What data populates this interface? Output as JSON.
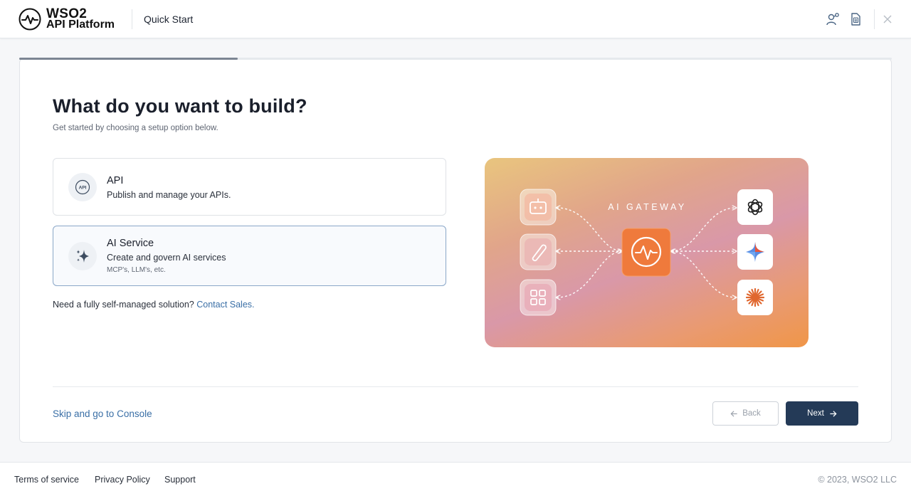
{
  "brand": {
    "line1": "WSO2",
    "line2": "API Platform"
  },
  "header": {
    "title": "Quick Start"
  },
  "progress": {
    "fraction": 0.25
  },
  "main": {
    "title": "What do you want to build?",
    "subtitle": "Get started by choosing a setup option below.",
    "options": [
      {
        "title": "API",
        "description": "Publish and manage your APIs.",
        "icon": "api-icon",
        "selected": false
      },
      {
        "title": "AI Service",
        "description": "Create and govern AI services",
        "note": "MCP's, LLM's, etc.",
        "icon": "sparkle-icon",
        "selected": true
      }
    ],
    "contact_prefix": "Need a fully self-managed solution? ",
    "contact_link": "Contact Sales."
  },
  "illustration": {
    "label": "AI GATEWAY",
    "left_icons": [
      "robot-icon",
      "paperclip-icon",
      "grid-icon"
    ],
    "center_icon": "pulse-icon",
    "right_icons": [
      "openai-icon",
      "gemini-icon",
      "claude-icon"
    ],
    "colors": {
      "gradient_start": "#e9c57e",
      "gradient_mid": "#d998a8",
      "gradient_end": "#f09648",
      "hub": "#ef7a3c"
    }
  },
  "actions": {
    "skip": "Skip and go to Console",
    "back": "Back",
    "next": "Next"
  },
  "footer": {
    "links": [
      "Terms of service",
      "Privacy Policy",
      "Support"
    ],
    "copyright": "© 2023, WSO2 LLC"
  },
  "colors": {
    "primary": "#243a57",
    "link": "#3a6fa6",
    "selected_border": "#8aa7c8"
  }
}
